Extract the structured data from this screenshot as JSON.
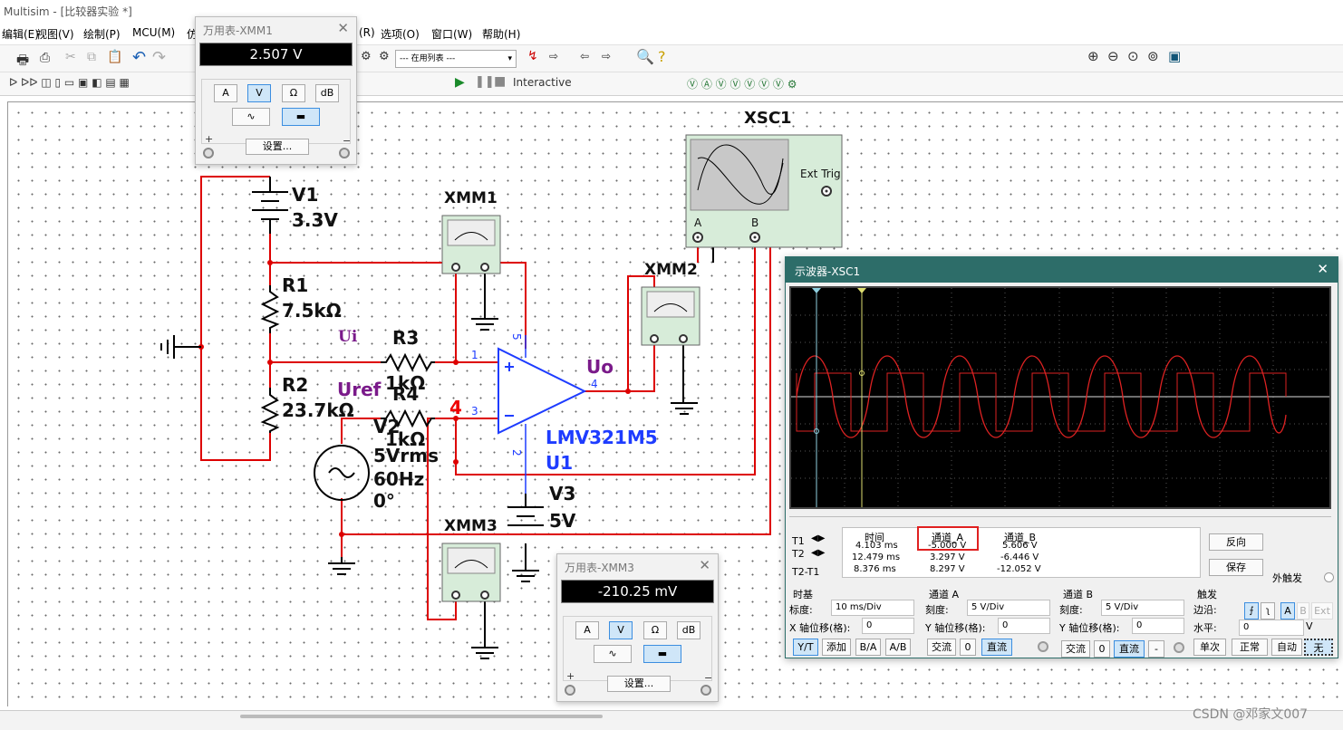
{
  "app": {
    "title": "Multisim - [比较器实验 *]"
  },
  "menu": [
    "编辑(E)",
    "视图(V)",
    "绘制(P)",
    "MCU(M)",
    "仿",
    "(R)",
    "选项(O)",
    "窗口(W)",
    "帮助(H)"
  ],
  "toolbar": {
    "inuse_list": "--- 在用列表 ---",
    "interactive": "Interactive"
  },
  "circuit": {
    "v1_name": "V1",
    "v1_val": "3.3V",
    "r1_name": "R1",
    "r1_val": "7.5kΩ",
    "r2_name": "R2",
    "r2_val": "23.7kΩ",
    "r3_name": "R3",
    "r3_val": "1kΩ",
    "r4_name": "R4",
    "r4_val": "1kΩ",
    "ui": "Ui",
    "uref": "Uref",
    "uo": "Uo",
    "node4": "4",
    "v2_name": "V2",
    "v2_amp": "5Vrms",
    "v2_freq": "60Hz",
    "v2_phase": "0°",
    "u1_part": "LMV321M5",
    "u1_name": "U1",
    "v3_name": "V3",
    "v3_val": "5V",
    "xmm1": "XMM1",
    "xmm2": "XMM2",
    "xmm3": "XMM3",
    "xsc1": "XSC1",
    "ext_trig": "Ext Trig",
    "scope_a": "A",
    "scope_b": "B",
    "pin1": "1",
    "pin2": "2",
    "pin3": "3",
    "pin4": "4",
    "pin5": "5"
  },
  "dmm1": {
    "title": "万用表-XMM1",
    "reading": "2.507 V",
    "btns": [
      "A",
      "V",
      "Ω",
      "dB"
    ],
    "settings": "设置...",
    "plus": "+",
    "minus": "−"
  },
  "dmm3": {
    "title": "万用表-XMM3",
    "reading": "-210.25 mV",
    "btns": [
      "A",
      "V",
      "Ω",
      "dB"
    ],
    "settings": "设置...",
    "plus": "+",
    "minus": "−"
  },
  "scope": {
    "title": "示波器-XSC1",
    "table": {
      "headers": [
        "时间",
        "通道_A",
        "通道_B"
      ],
      "rows": [
        {
          "label": "T1",
          "t": "4.103 ms",
          "a": "-5.000 V",
          "b": "5.606 V"
        },
        {
          "label": "T2",
          "t": "12.479 ms",
          "a": "3.297 V",
          "b": "-6.446 V"
        },
        {
          "label": "T2-T1",
          "t": "8.376 ms",
          "a": "8.297 V",
          "b": "-12.052 V"
        }
      ]
    },
    "reverse": "反向",
    "save": "保存",
    "ext_trigger": "外触发",
    "timebase": {
      "title": "时基",
      "scale_lbl": "标度:",
      "scale": "10 ms/Div",
      "xpos_lbl": "X 轴位移(格):",
      "xpos": "0",
      "yt": "Y/T",
      "add": "添加",
      "ba": "B/A",
      "ab": "A/B"
    },
    "cha": {
      "title": "通道 A",
      "scale_lbl": "刻度:",
      "scale": "5  V/Div",
      "ypos_lbl": "Y 轴位移(格):",
      "ypos": "0",
      "ac": "交流",
      "zero": "0",
      "dc": "直流"
    },
    "chb": {
      "title": "通道 B",
      "scale_lbl": "刻度:",
      "scale": "5  V/Div",
      "ypos_lbl": "Y 轴位移(格):",
      "ypos": "0",
      "ac": "交流",
      "zero": "0",
      "dc": "直流",
      "minus": "-"
    },
    "trigger": {
      "title": "触发",
      "edge_lbl": "边沿:",
      "a": "A",
      "b": "B",
      "ext": "Ext",
      "level_lbl": "水平:",
      "level": "0",
      "unit": "V",
      "single": "单次",
      "normal": "正常",
      "auto": "自动",
      "none": "无"
    }
  },
  "watermark": "CSDN @邓家文007"
}
